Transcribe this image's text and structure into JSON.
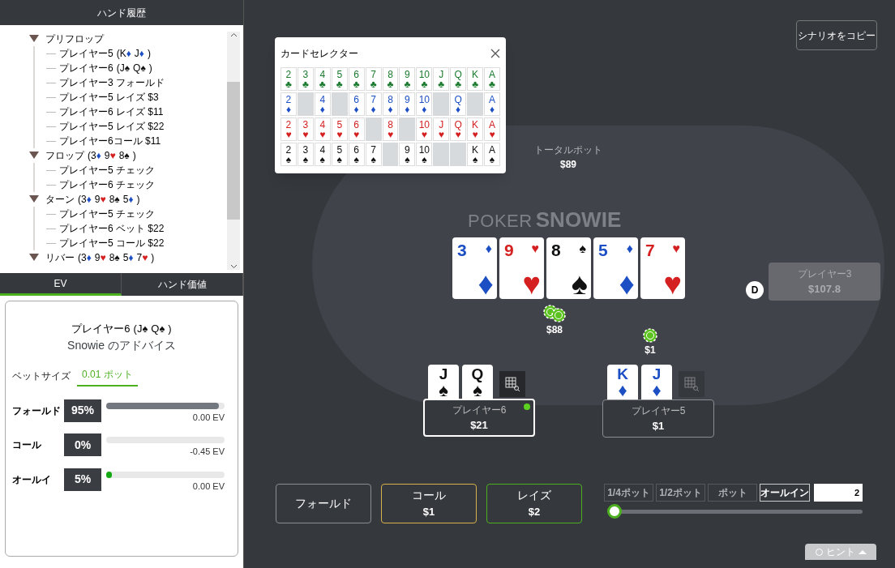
{
  "history": {
    "title": "ハンド履歴",
    "stages": [
      {
        "label": "プリフロップ",
        "expanded": true,
        "children": [
          {
            "text": "プレイヤー5",
            "open": "(",
            "close": ")",
            "cards": [
              {
                "rank": "K",
                "suit": "♦",
                "color": "#1d4fc4"
              },
              {
                "rank": "J",
                "suit": "♦",
                "color": "#1d4fc4"
              }
            ]
          },
          {
            "text": "プレイヤー6",
            "open": "(",
            "close": ")",
            "cards": [
              {
                "rank": "J",
                "suit": "♠",
                "color": "#111111"
              },
              {
                "rank": "Q",
                "suit": "♠",
                "color": "#111111"
              }
            ]
          },
          {
            "text": "プレイヤー3 フォールド"
          },
          {
            "text": "プレイヤー5 レイズ $3"
          },
          {
            "text": "プレイヤー6 レイズ $11"
          },
          {
            "text": "プレイヤー5 レイズ $22"
          },
          {
            "text": "プレイヤー6コール $11"
          }
        ]
      },
      {
        "label": "フロップ",
        "open": "(",
        "close": ")",
        "cards": [
          {
            "rank": "3",
            "suit": "♦",
            "color": "#1d4fc4"
          },
          {
            "rank": "9",
            "suit": "♥",
            "color": "#d42020"
          },
          {
            "rank": "8",
            "suit": "♠",
            "color": "#111111"
          }
        ],
        "expanded": true,
        "children": [
          {
            "text": "プレイヤー5 チェック"
          },
          {
            "text": "プレイヤー6 チェック"
          }
        ]
      },
      {
        "label": "ターン",
        "open": "(",
        "close": ")",
        "cards": [
          {
            "rank": "3",
            "suit": "♦",
            "color": "#1d4fc4"
          },
          {
            "rank": "9",
            "suit": "♥",
            "color": "#d42020"
          },
          {
            "rank": "8",
            "suit": "♠",
            "color": "#111111"
          },
          {
            "rank": "5",
            "suit": "♦",
            "color": "#1d4fc4"
          }
        ],
        "expanded": true,
        "children": [
          {
            "text": "プレイヤー5 チェック"
          },
          {
            "text": "プレイヤー6 ベット $22"
          },
          {
            "text": "プレイヤー5 コール $22"
          }
        ]
      },
      {
        "label": "リバー",
        "open": "(",
        "close": ")",
        "cards": [
          {
            "rank": "3",
            "suit": "♦",
            "color": "#1d4fc4"
          },
          {
            "rank": "9",
            "suit": "♥",
            "color": "#d42020"
          },
          {
            "rank": "8",
            "suit": "♠",
            "color": "#111111"
          },
          {
            "rank": "5",
            "suit": "♦",
            "color": "#1d4fc4"
          },
          {
            "rank": "7",
            "suit": "♥",
            "color": "#d42020"
          }
        ],
        "expanded": true
      }
    ]
  },
  "tabs": [
    {
      "label": "EV",
      "selected": true
    },
    {
      "label": "ハンド価値",
      "selected": false
    }
  ],
  "advice": {
    "player": "プレイヤー6",
    "open": "(",
    "close": ")",
    "cards": [
      {
        "rank": "J",
        "suit": "♠",
        "color": "#111111"
      },
      {
        "rank": "Q",
        "suit": "♠",
        "color": "#111111"
      }
    ],
    "subtitle": "Snowie のアドバイス",
    "bet_size_label": "ベットサイズ",
    "bet_sizes": [
      {
        "label": "0.01 ポット",
        "selected": true
      }
    ],
    "actions": [
      {
        "label": "フォールド",
        "percent": "95%",
        "level": 0.95,
        "ev": "0.00 EV",
        "color": "#737780"
      },
      {
        "label": "コール",
        "percent": "0%",
        "ev": "-0.45 EV"
      },
      {
        "label": "オールイ",
        "percent": "5%",
        "level": 0.05,
        "ev": "0.00 EV",
        "color": "#11a811"
      }
    ]
  },
  "copy_button": "シナリオをコピー",
  "card_selector": {
    "title": "カードセレクター",
    "rows": [
      {
        "color": "#1a7a2e",
        "cards": [
          {
            "rank": "2",
            "suit": "♣",
            "available": true
          },
          {
            "rank": "3",
            "suit": "♣",
            "available": true
          },
          {
            "rank": "4",
            "suit": "♣",
            "available": true
          },
          {
            "rank": "5",
            "suit": "♣",
            "available": true
          },
          {
            "rank": "6",
            "suit": "♣",
            "available": true
          },
          {
            "rank": "7",
            "suit": "♣",
            "available": true
          },
          {
            "rank": "8",
            "suit": "♣",
            "available": true
          },
          {
            "rank": "9",
            "suit": "♣",
            "available": true
          },
          {
            "rank": "10",
            "suit": "♣",
            "available": true
          },
          {
            "rank": "J",
            "suit": "♣",
            "available": true
          },
          {
            "rank": "Q",
            "suit": "♣",
            "available": true
          },
          {
            "rank": "K",
            "suit": "♣",
            "available": true
          },
          {
            "rank": "A",
            "suit": "♣",
            "available": true
          }
        ]
      },
      {
        "color": "#1d4fc4",
        "cards": [
          {
            "rank": "2",
            "suit": "♦",
            "available": true
          },
          {
            "available": false
          },
          {
            "rank": "4",
            "suit": "♦",
            "available": true
          },
          {
            "available": false
          },
          {
            "rank": "6",
            "suit": "♦",
            "available": true
          },
          {
            "rank": "7",
            "suit": "♦",
            "available": true
          },
          {
            "rank": "8",
            "suit": "♦",
            "available": true
          },
          {
            "rank": "9",
            "suit": "♦",
            "available": true
          },
          {
            "rank": "10",
            "suit": "♦",
            "available": true
          },
          {
            "available": false
          },
          {
            "rank": "Q",
            "suit": "♦",
            "available": true
          },
          {
            "available": false
          },
          {
            "rank": "A",
            "suit": "♦",
            "available": true
          }
        ]
      },
      {
        "color": "#d42020",
        "cards": [
          {
            "rank": "2",
            "suit": "♥",
            "available": true
          },
          {
            "rank": "3",
            "suit": "♥",
            "available": true
          },
          {
            "rank": "4",
            "suit": "♥",
            "available": true
          },
          {
            "rank": "5",
            "suit": "♥",
            "available": true
          },
          {
            "rank": "6",
            "suit": "♥",
            "available": true
          },
          {
            "available": false
          },
          {
            "rank": "8",
            "suit": "♥",
            "available": true
          },
          {
            "available": false
          },
          {
            "rank": "10",
            "suit": "♥",
            "available": true
          },
          {
            "rank": "J",
            "suit": "♥",
            "available": true
          },
          {
            "rank": "Q",
            "suit": "♥",
            "available": true
          },
          {
            "rank": "K",
            "suit": "♥",
            "available": true
          },
          {
            "rank": "A",
            "suit": "♥",
            "available": true
          }
        ]
      },
      {
        "color": "#111111",
        "cards": [
          {
            "rank": "2",
            "suit": "♠",
            "available": true
          },
          {
            "rank": "3",
            "suit": "♠",
            "available": true
          },
          {
            "rank": "4",
            "suit": "♠",
            "available": true
          },
          {
            "rank": "5",
            "suit": "♠",
            "available": true
          },
          {
            "rank": "6",
            "suit": "♠",
            "available": true
          },
          {
            "rank": "7",
            "suit": "♠",
            "available": true
          },
          {
            "available": false
          },
          {
            "rank": "9",
            "suit": "♠",
            "available": true
          },
          {
            "rank": "10",
            "suit": "♠",
            "available": true
          },
          {
            "available": false
          },
          {
            "available": false
          },
          {
            "rank": "K",
            "suit": "♠",
            "available": true
          },
          {
            "rank": "A",
            "suit": "♠",
            "available": true
          }
        ]
      }
    ]
  },
  "table": {
    "total_pot": {
      "label": "トータルポット",
      "amount": "$89"
    },
    "logo": {
      "prefix": "POKER",
      "name": "SNOWIE"
    },
    "board": [
      {
        "rank": "3",
        "suit": "♦",
        "color": "#1d4fc4"
      },
      {
        "rank": "9",
        "suit": "♥",
        "color": "#d42020"
      },
      {
        "rank": "8",
        "suit": "♠",
        "color": "#111111"
      },
      {
        "rank": "5",
        "suit": "♦",
        "color": "#1d4fc4"
      },
      {
        "rank": "7",
        "suit": "♥",
        "color": "#d42020"
      }
    ],
    "pot": "$88",
    "players": [
      {
        "name": "プレイヤー3",
        "stack": "$107.8",
        "folded": true,
        "acting": false,
        "dealer": "D"
      },
      {
        "name": "プレイヤー6",
        "stack": "$21",
        "folded": false,
        "acting": true,
        "range_active": true,
        "cards": [
          {
            "rank": "J",
            "suit": "♠",
            "color": "#111111"
          },
          {
            "rank": "Q",
            "suit": "♠",
            "color": "#111111"
          }
        ]
      },
      {
        "name": "プレイヤー5",
        "stack": "$1",
        "folded": false,
        "acting": false,
        "range_active": false,
        "bet": "$1",
        "cards": [
          {
            "rank": "K",
            "suit": "♦",
            "color": "#1d4fc4"
          },
          {
            "rank": "J",
            "suit": "♦",
            "color": "#1d4fc4"
          }
        ]
      }
    ]
  },
  "controls": {
    "actions": [
      {
        "kind": "fold",
        "label": "フォールド"
      },
      {
        "kind": "call",
        "label": "コール",
        "amount": "$1"
      },
      {
        "kind": "raise",
        "label": "レイズ",
        "amount": "$2"
      }
    ],
    "presets": [
      {
        "label": "1/4ポット",
        "selected": false
      },
      {
        "label": "1/2ポット",
        "selected": false
      },
      {
        "label": "ポット",
        "selected": false
      },
      {
        "label": "オールイン",
        "selected": true
      }
    ],
    "bet_input": "2",
    "slider": {
      "level": 0
    },
    "hint": "ヒント"
  }
}
